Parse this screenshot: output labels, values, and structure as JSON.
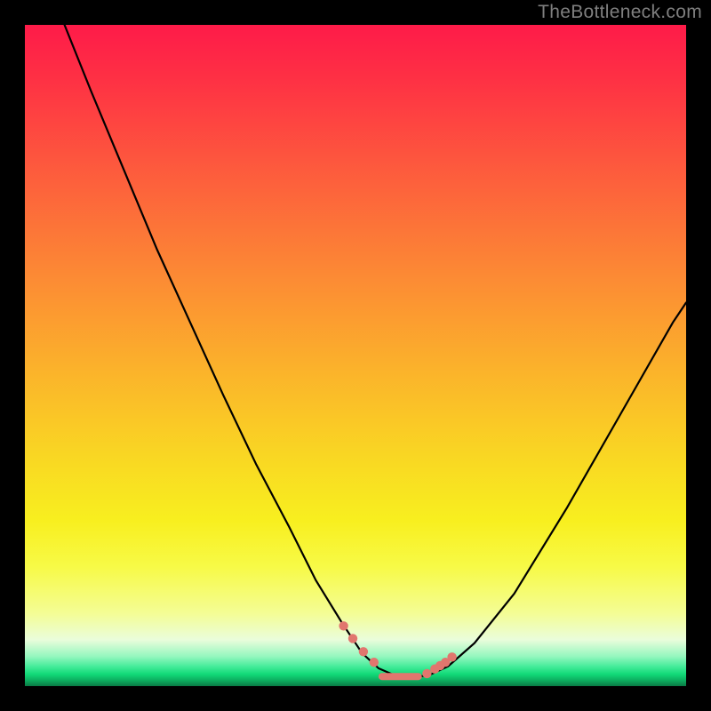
{
  "watermark": "TheBottleneck.com",
  "colors": {
    "frame_bg": "#000000",
    "curve_stroke": "#000000",
    "dot_fill": "#e1766e",
    "watermark_text": "#7f7f7f",
    "gradient_top": "#fe1b49",
    "gradient_mid": "#f9d623",
    "gradient_bottom": "#0a7a45"
  },
  "chart_data": {
    "type": "line",
    "title": "",
    "xlabel": "",
    "ylabel": "",
    "xlim": [
      0,
      100
    ],
    "ylim": [
      0,
      100
    ],
    "grid": false,
    "legend": null,
    "series": [
      {
        "name": "bottleneck-curve",
        "x": [
          6,
          10,
          15,
          20,
          25,
          30,
          35,
          40,
          44,
          48,
          51,
          53.5,
          56,
          58.5,
          61,
          64,
          68,
          74,
          82,
          90,
          98,
          100
        ],
        "y": [
          100,
          90,
          78,
          66,
          55,
          44,
          33.5,
          24,
          16,
          9.5,
          5,
          2.7,
          1.6,
          1.4,
          1.6,
          3,
          6.5,
          14,
          27,
          41,
          55,
          58
        ]
      }
    ],
    "highlight_points": {
      "name": "near-optimal-dots",
      "x": [
        48.2,
        49.6,
        51.2,
        52.8,
        60.8,
        62.0,
        62.8,
        63.6,
        64.6
      ],
      "y": [
        9.1,
        7.2,
        5.2,
        3.6,
        1.9,
        2.6,
        3.1,
        3.6,
        4.4
      ]
    },
    "flat_segment": {
      "name": "optimal-flat",
      "x": [
        54.0,
        59.5
      ],
      "y": [
        1.45,
        1.45
      ]
    }
  }
}
